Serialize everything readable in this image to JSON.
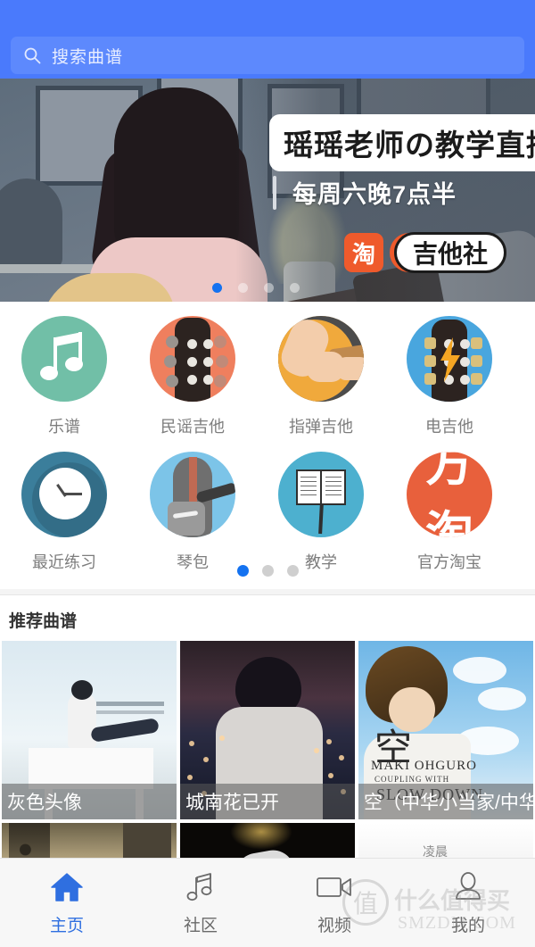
{
  "search": {
    "placeholder": "搜索曲谱",
    "icon": "search-icon"
  },
  "banner": {
    "title": "瑶瑶老师の教学直播",
    "subtitle": "每周六晚7点半",
    "brand_logo_text": "淘",
    "brand_name": "吉他社",
    "dots": 4,
    "active_dot": 0,
    "active_dot_color": "#1472f0"
  },
  "grid": {
    "items": [
      {
        "label": "乐谱",
        "icon": "music-note-icon",
        "color": "#71bfa7"
      },
      {
        "label": "民谣吉他",
        "icon": "acoustic-guitar-headstock-icon",
        "color": "#ef7f5e"
      },
      {
        "label": "指弹吉他",
        "icon": "fingerstyle-guitar-icon",
        "color": "#f0a93c"
      },
      {
        "label": "电吉他",
        "icon": "electric-guitar-headstock-icon",
        "color": "#49a6de"
      },
      {
        "label": "最近练习",
        "icon": "clock-icon",
        "color": "#3b7e9b"
      },
      {
        "label": "琴包",
        "icon": "gig-bag-icon",
        "color": "#7cc4e8"
      },
      {
        "label": "教学",
        "icon": "music-stand-icon",
        "color": "#4db0cf"
      },
      {
        "label": "官方淘宝",
        "icon": "taobao-icon",
        "color": "#e8603c"
      }
    ],
    "dots": 3,
    "active_dot": 0,
    "active_dot_color": "#1472f0"
  },
  "recommended": {
    "title": "推荐曲谱",
    "row1": [
      {
        "title": "灰色头像"
      },
      {
        "title": "城南花已开"
      },
      {
        "title": "空（中华小当家/中华一番"
      }
    ],
    "row2": [
      {
        "title": ""
      },
      {
        "title": ""
      },
      {
        "title": ""
      }
    ],
    "card3_art": {
      "kanji": "空",
      "artist": "MAKI OHGURO",
      "coupling": "COUPLING WITH",
      "song": "SLOW DOWN"
    }
  },
  "tabbar": {
    "items": [
      {
        "label": "主页",
        "icon": "home-icon",
        "active": true
      },
      {
        "label": "社区",
        "icon": "music-note-icon",
        "active": false
      },
      {
        "label": "视频",
        "icon": "video-camera-icon",
        "active": false
      },
      {
        "label": "我的",
        "icon": "person-icon",
        "active": false
      }
    ],
    "active_color": "#2f6fe0"
  },
  "watermark": {
    "mark": "值",
    "cn": "什么值得买",
    "en": "SMZDM.COM"
  }
}
